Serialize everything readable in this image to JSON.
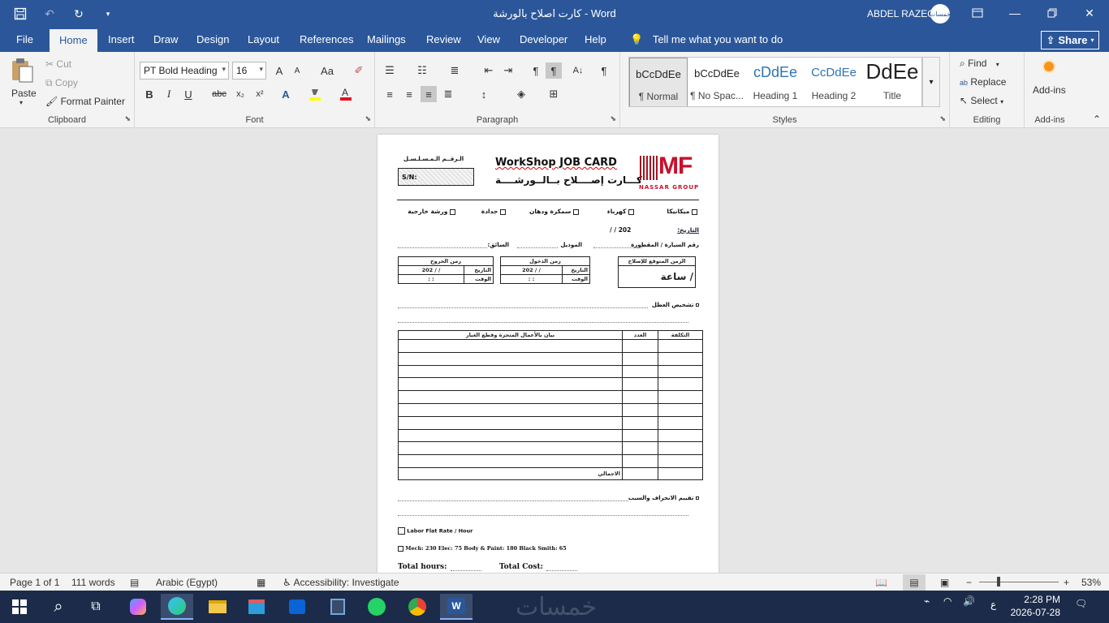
{
  "window": {
    "title": "كارت اصلاح بالورشة  -  Word",
    "user": "ABDEL RAZEQ",
    "avatar_text": "خمسات"
  },
  "tabs": [
    "File",
    "Home",
    "Insert",
    "Draw",
    "Design",
    "Layout",
    "References",
    "Mailings",
    "Review",
    "View",
    "Developer",
    "Help"
  ],
  "tell_me": "Tell me what you want to do",
  "share_label": "Share",
  "clipboard": {
    "paste": "Paste",
    "cut": "Cut",
    "copy": "Copy",
    "format_painter": "Format Painter",
    "label": "Clipboard"
  },
  "font": {
    "name": "PT Bold Heading",
    "size": "16",
    "label": "Font",
    "bold": "B",
    "italic": "I",
    "underline": "U",
    "strike": "abc",
    "subscript": "x₂",
    "superscript": "x²",
    "grow": "A",
    "case": "Aa",
    "highlight_color": "#ffff00",
    "font_color": "#e81123"
  },
  "paragraph": {
    "label": "Paragraph"
  },
  "styles": {
    "label": "Styles",
    "items": [
      {
        "preview": "bCcDdEe",
        "name": "¶ Normal"
      },
      {
        "preview": "bCcDdEe",
        "name": "¶ No Spac..."
      },
      {
        "preview": "cDdEe",
        "name": "Heading 1"
      },
      {
        "preview": "CcDdEe",
        "name": "Heading 2"
      },
      {
        "preview": "DdEe",
        "name": "Title"
      }
    ]
  },
  "editing": {
    "find": "Find",
    "replace": "Replace",
    "select": "Select",
    "label": "Editing"
  },
  "addins": {
    "button": "Add-ins",
    "label": "Add-ins"
  },
  "doc": {
    "serial_label": "الـرقــم الـمـسـلـسـل",
    "sn": "S/N:",
    "title_en": "WorkShop JOB CARD",
    "title_ar": "كـــارت إصــــلاح بــالــورشــــة",
    "logo": "MF",
    "logo_sub": "NASSAR GROUP",
    "categories": [
      "ميكانيكا",
      "كهرباء",
      "سمكرة ودهان",
      "حدادة",
      "ورشة خارجية"
    ],
    "date_label": "التاريخ:",
    "date_value": "/       /       202",
    "car_plate": "رقم السيارة / المقطورة",
    "model": "الموديل",
    "driver": "السائق:",
    "expected_time": "الزمن المتوقع للإصلاح",
    "hour": "/ ساعة",
    "entry_time": "زمن الدخول",
    "exit_time": "زمن الخروج",
    "date_short": "التاريخ",
    "time_short": "الوقت",
    "date_fill": "202      /      /",
    "time_fill": ":        :",
    "diagnosis": "تشخيص العطل",
    "col_cost": "التكلفة",
    "col_qty": "العدد",
    "col_desc": "بيان بالأعمال المنجزة وقطع الغيار",
    "total": "الاجمالي",
    "deviation": "تقييم الانحراف والسبب",
    "labor": "Labor Flat Rate / Hour",
    "rates": "Mech:   230      Elec:    75      Body & Paint:   180      Black Smith:    65",
    "total_hours": "Total hours:",
    "total_cost": "Total Cost:"
  },
  "status": {
    "page": "Page 1 of 1",
    "words": "111 words",
    "language": "Arabic (Egypt)",
    "accessibility": "Accessibility: Investigate",
    "zoom": "53%"
  },
  "taskbar": {
    "time": "2:28 PM",
    "date": "2026-07-28",
    "lang": "ع",
    "watermark": "خمسات"
  }
}
